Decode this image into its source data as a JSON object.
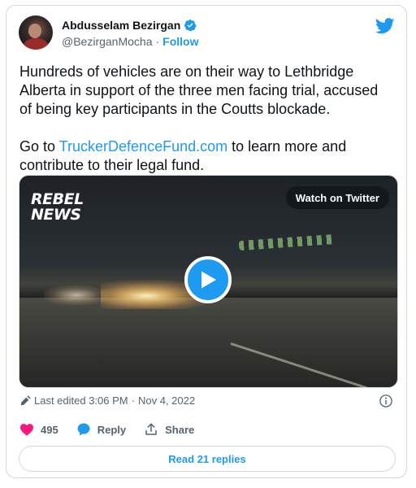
{
  "author": {
    "name": "Abdusselam Bezirgan",
    "handle": "@BezirganMocha",
    "separator": "·",
    "follow_label": "Follow"
  },
  "tweet": {
    "paragraph1": "Hundreds of vehicles are on their way to Lethbridge Alberta in support of the three men facing trial, accused of being key participants in the Coutts blockade.",
    "paragraph2_before": "Go to ",
    "paragraph2_link": "TruckerDefenceFund.com",
    "paragraph2_after": " to learn more and contribute to their legal fund."
  },
  "media": {
    "brand_line1": "REBEL",
    "brand_line2": "NEWS",
    "watch_label": "Watch on Twitter"
  },
  "meta": {
    "edited_label": "Last edited 3:06 PM",
    "separator": "·",
    "date": "Nov 4, 2022"
  },
  "actions": {
    "like_count": "495",
    "reply_label": "Reply",
    "share_label": "Share"
  },
  "replies_button": "Read 21 replies",
  "colors": {
    "accent": "#1d9bf0",
    "like": "#f91880",
    "text": "#0f1419",
    "muted": "#536471",
    "border": "#cfd9de"
  },
  "icons": [
    "twitter-bird-icon",
    "verified-badge-icon",
    "play-icon",
    "pencil-icon",
    "info-icon",
    "heart-icon",
    "reply-bubble-icon",
    "share-icon"
  ]
}
